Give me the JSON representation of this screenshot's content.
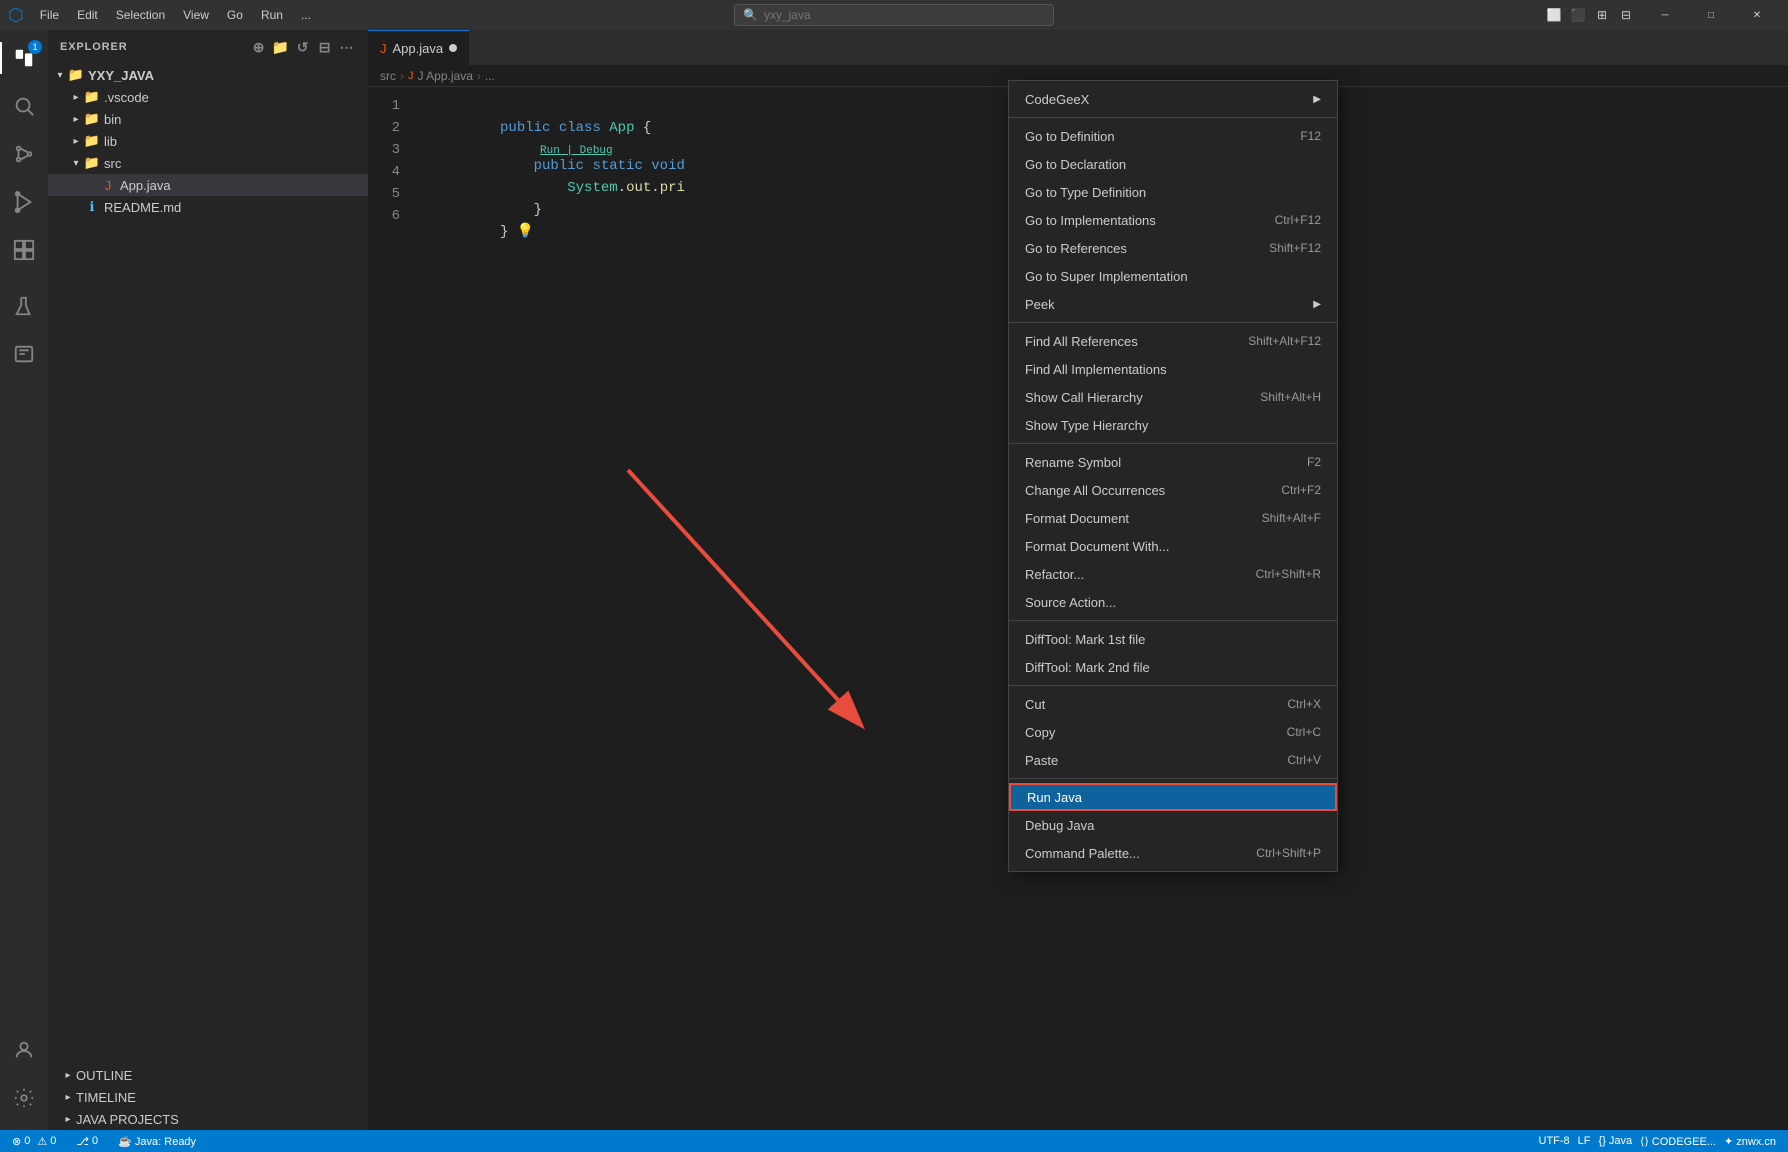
{
  "titlebar": {
    "menus": [
      "File",
      "Edit",
      "Selection",
      "View",
      "Go",
      "Run",
      "..."
    ],
    "search_placeholder": "yxy_java",
    "search_icon": "🔍"
  },
  "sidebar": {
    "header": "EXPLORER",
    "project": "YXY_JAVA",
    "items": [
      {
        "label": ".vscode",
        "type": "folder",
        "indent": 1,
        "expanded": false
      },
      {
        "label": "bin",
        "type": "folder",
        "indent": 1,
        "expanded": false
      },
      {
        "label": "lib",
        "type": "folder",
        "indent": 1,
        "expanded": false
      },
      {
        "label": "src",
        "type": "folder",
        "indent": 1,
        "expanded": true
      },
      {
        "label": "App.java",
        "type": "java",
        "indent": 2,
        "selected": true
      },
      {
        "label": "README.md",
        "type": "info",
        "indent": 1
      }
    ],
    "outline": "OUTLINE",
    "timeline": "TIMELINE",
    "java_projects": "JAVA PROJECTS"
  },
  "editor": {
    "tab_label": "App.java",
    "breadcrumb": [
      "src",
      "J App.java",
      "..."
    ],
    "lines": [
      "public class App {",
      "    public static void",
      "        System.out.pri",
      "    }",
      "} ",
      ""
    ],
    "run_debug": "Run | Debug"
  },
  "context_menu": {
    "items": [
      {
        "label": "CodeGeeX",
        "shortcut": "",
        "arrow": true,
        "separator_after": false
      },
      {
        "label": "Go to Definition",
        "shortcut": "F12",
        "separator_after": false
      },
      {
        "label": "Go to Declaration",
        "shortcut": "",
        "separator_after": false
      },
      {
        "label": "Go to Type Definition",
        "shortcut": "",
        "separator_after": false
      },
      {
        "label": "Go to Implementations",
        "shortcut": "Ctrl+F12",
        "separator_after": false
      },
      {
        "label": "Go to References",
        "shortcut": "Shift+F12",
        "separator_after": false
      },
      {
        "label": "Go to Super Implementation",
        "shortcut": "",
        "separator_after": false
      },
      {
        "label": "Peek",
        "shortcut": "",
        "arrow": true,
        "separator_after": true
      },
      {
        "label": "Find All References",
        "shortcut": "Shift+Alt+F12",
        "separator_after": false
      },
      {
        "label": "Find All Implementations",
        "shortcut": "",
        "separator_after": false
      },
      {
        "label": "Show Call Hierarchy",
        "shortcut": "Shift+Alt+H",
        "separator_after": false
      },
      {
        "label": "Show Type Hierarchy",
        "shortcut": "",
        "separator_after": true
      },
      {
        "label": "Rename Symbol",
        "shortcut": "F2",
        "separator_after": false
      },
      {
        "label": "Change All Occurrences",
        "shortcut": "Ctrl+F2",
        "separator_after": false
      },
      {
        "label": "Format Document",
        "shortcut": "Shift+Alt+F",
        "separator_after": false
      },
      {
        "label": "Format Document With...",
        "shortcut": "",
        "separator_after": false
      },
      {
        "label": "Refactor...",
        "shortcut": "Ctrl+Shift+R",
        "separator_after": false
      },
      {
        "label": "Source Action...",
        "shortcut": "",
        "separator_after": true
      },
      {
        "label": "DiffTool: Mark 1st file",
        "shortcut": "",
        "separator_after": false
      },
      {
        "label": "DiffTool: Mark 2nd file",
        "shortcut": "",
        "separator_after": true
      },
      {
        "label": "Cut",
        "shortcut": "Ctrl+X",
        "separator_after": false
      },
      {
        "label": "Copy",
        "shortcut": "Ctrl+C",
        "separator_after": false
      },
      {
        "label": "Paste",
        "shortcut": "Ctrl+V",
        "separator_after": true
      },
      {
        "label": "Run Java",
        "shortcut": "",
        "highlighted": true,
        "separator_after": false
      },
      {
        "label": "Debug Java",
        "shortcut": "",
        "separator_after": false
      },
      {
        "label": "Command Palette...",
        "shortcut": "Ctrl+Shift+P",
        "separator_after": false
      }
    ]
  },
  "status_bar": {
    "errors": "⊗ 0",
    "warnings": "⚠ 0",
    "git": "⎇ 0",
    "java_ready": "☕ Java: Ready",
    "encoding": "UTF-8",
    "line_ending": "LF",
    "language": "{} Java",
    "codegee": "⟨⟩ CODEGEE...",
    "extra": "✦ znwx.cn"
  }
}
